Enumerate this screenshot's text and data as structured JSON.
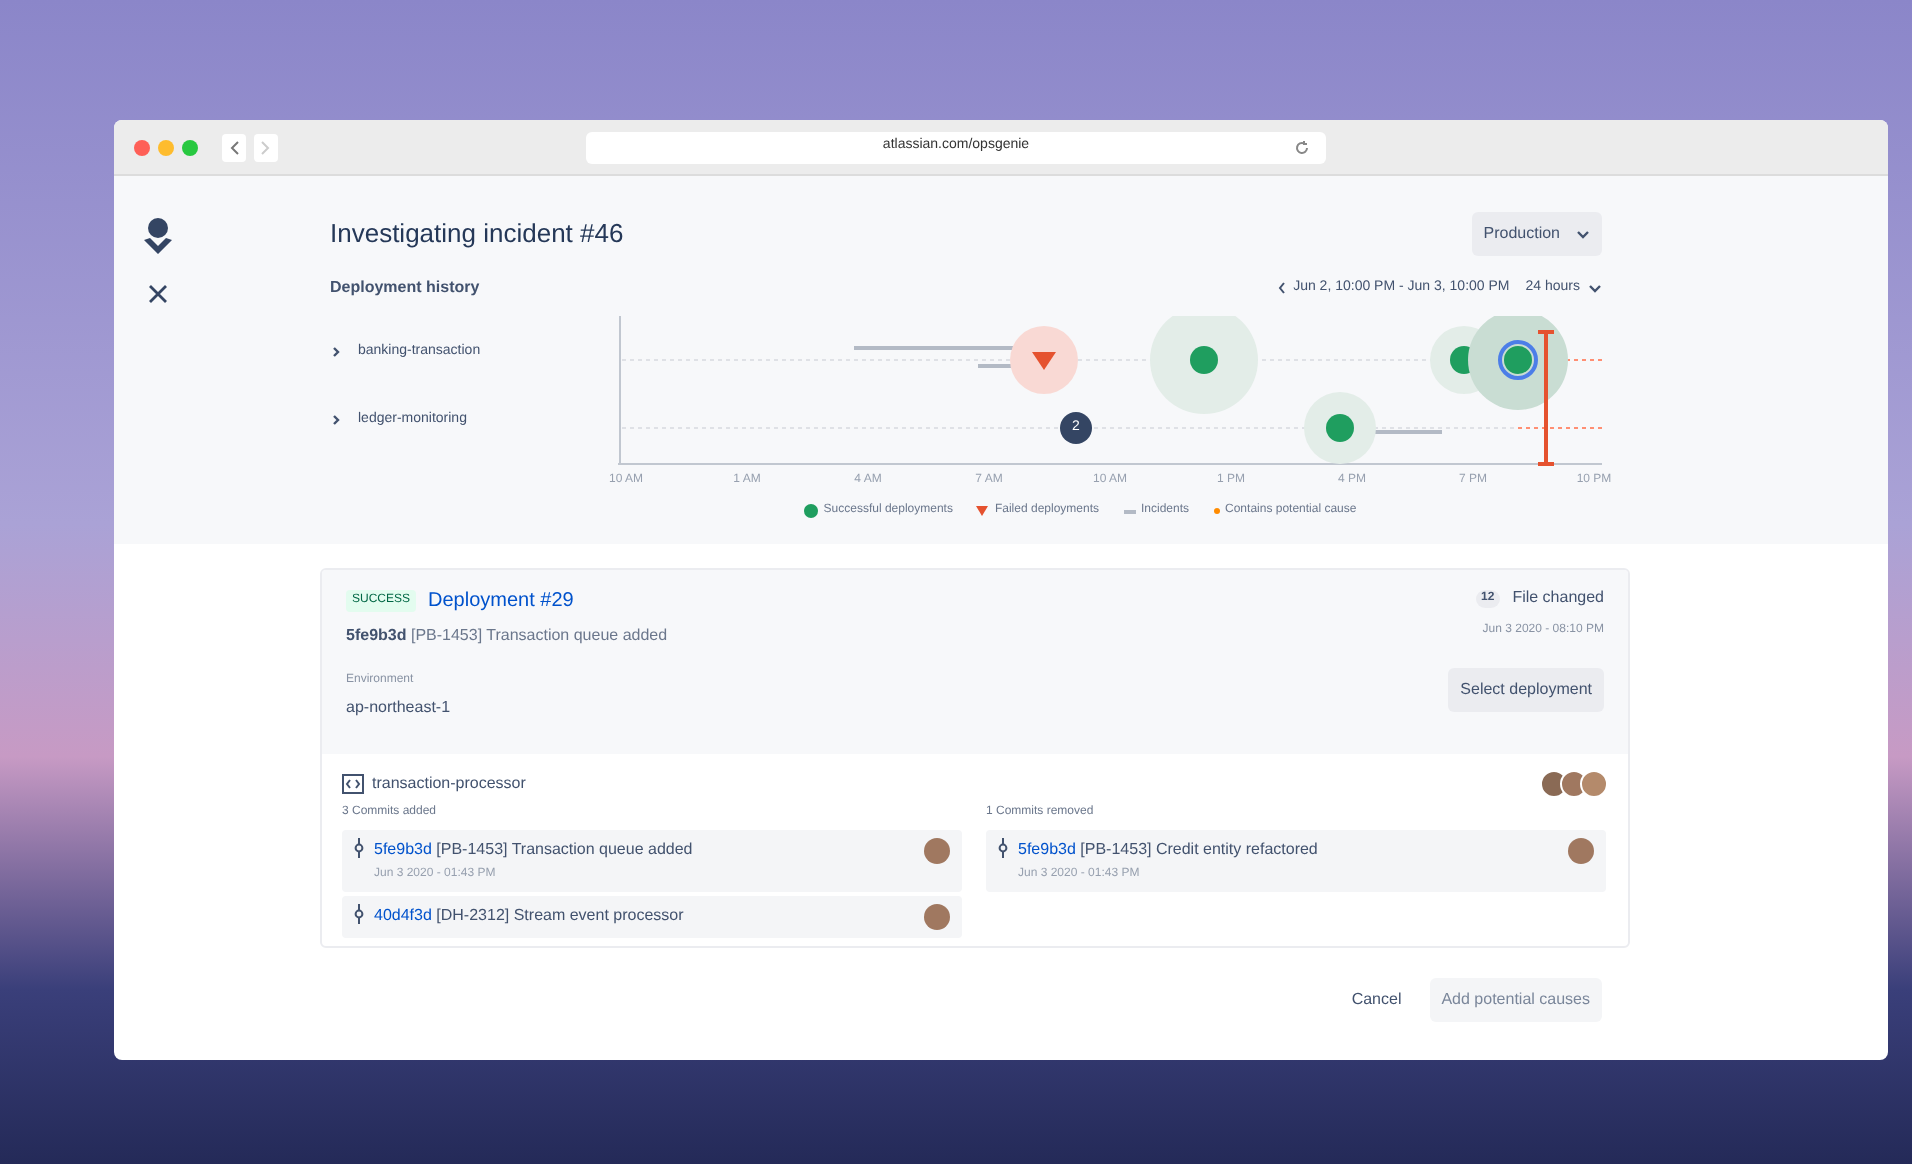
{
  "browser": {
    "url": "atlassian.com/opsgenie"
  },
  "header": {
    "title": "Investigating incident #46",
    "environment": "Production"
  },
  "history": {
    "title": "Deployment history",
    "range": "Jun 2, 10:00 PM - Jun 3, 10:00 PM",
    "period": "24 hours",
    "rows": [
      {
        "label": "banking-transaction",
        "expanded": false
      },
      {
        "label": "ledger-monitoring",
        "expanded": false
      }
    ],
    "group_count": "2",
    "ticks": [
      "10 AM",
      "1 AM",
      "4 AM",
      "7 AM",
      "10 AM",
      "1 PM",
      "4 PM",
      "7 PM",
      "10 PM"
    ],
    "legend": [
      {
        "kind": "success",
        "label": "Successful deployments"
      },
      {
        "kind": "failed",
        "label": "Failed deployments"
      },
      {
        "kind": "incident",
        "label": "Incidents"
      },
      {
        "kind": "cause",
        "label": "Contains potential cause"
      }
    ]
  },
  "deployment": {
    "status": "SUCCESS",
    "title": "Deployment #29",
    "hash": "5fe9b3d",
    "message": "[PB-1453] Transaction queue added",
    "files_count": "12",
    "files_label": "File changed",
    "date": "Jun 3 2020 - 08:10 PM",
    "env_label": "Environment",
    "env_value": "ap-northeast-1",
    "select_button": "Select deployment"
  },
  "repo": {
    "name": "transaction-processor",
    "added": {
      "title": "3 Commits added",
      "commits": [
        {
          "hash": "5fe9b3d",
          "message": "[PB-1453] Transaction queue added",
          "date": "Jun 3 2020 - 01:43 PM"
        },
        {
          "hash": "40d4f3d",
          "message": "[DH-2312] Stream event processor"
        }
      ]
    },
    "removed": {
      "title": "1 Commits removed",
      "commits": [
        {
          "hash": "5fe9b3d",
          "message": "[PB-1453] Credit entity refactored",
          "date": "Jun 3 2020 - 01:43 PM"
        }
      ]
    }
  },
  "footer": {
    "cancel": "Cancel",
    "confirm": "Add potential causes",
    "confirm_disabled": true
  }
}
